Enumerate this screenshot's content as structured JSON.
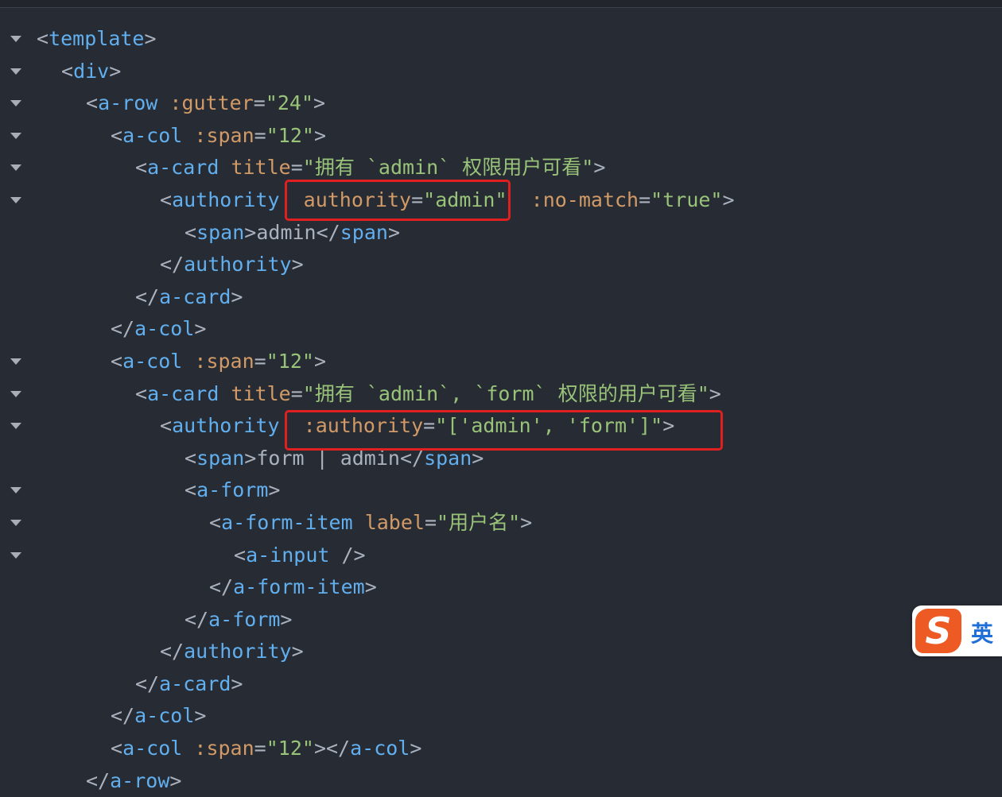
{
  "editor": {
    "lines": [
      {
        "fold": true,
        "indent": 0,
        "tokens": [
          [
            "punct",
            "<"
          ],
          [
            "tag",
            "template"
          ],
          [
            "punct",
            ">"
          ]
        ]
      },
      {
        "fold": true,
        "indent": 1,
        "tokens": [
          [
            "punct",
            "<"
          ],
          [
            "tag",
            "div"
          ],
          [
            "punct",
            ">"
          ]
        ]
      },
      {
        "fold": true,
        "indent": 2,
        "tokens": [
          [
            "punct",
            "<"
          ],
          [
            "tag",
            "a-row"
          ],
          [
            "text",
            " "
          ],
          [
            "attr",
            ":gutter"
          ],
          [
            "punct",
            "="
          ],
          [
            "str",
            "\"24\""
          ],
          [
            "punct",
            ">"
          ]
        ]
      },
      {
        "fold": true,
        "indent": 3,
        "tokens": [
          [
            "punct",
            "<"
          ],
          [
            "tag",
            "a-col"
          ],
          [
            "text",
            " "
          ],
          [
            "attr",
            ":span"
          ],
          [
            "punct",
            "="
          ],
          [
            "str",
            "\"12\""
          ],
          [
            "punct",
            ">"
          ]
        ]
      },
      {
        "fold": true,
        "indent": 4,
        "tokens": [
          [
            "punct",
            "<"
          ],
          [
            "tag",
            "a-card"
          ],
          [
            "text",
            " "
          ],
          [
            "attr",
            "title"
          ],
          [
            "punct",
            "="
          ],
          [
            "str",
            "\"拥有 `admin` 权限用户可看\""
          ],
          [
            "punct",
            ">"
          ]
        ]
      },
      {
        "fold": true,
        "indent": 5,
        "tokens": [
          [
            "punct",
            "<"
          ],
          [
            "tag",
            "authority"
          ],
          [
            "text",
            "  "
          ],
          [
            "attr",
            "authority"
          ],
          [
            "punct",
            "="
          ],
          [
            "str",
            "\"admin\""
          ],
          [
            "text",
            "  "
          ],
          [
            "attr",
            ":no-match"
          ],
          [
            "punct",
            "="
          ],
          [
            "str",
            "\"true\""
          ],
          [
            "punct",
            ">"
          ]
        ]
      },
      {
        "fold": false,
        "indent": 6,
        "tokens": [
          [
            "punct",
            "<"
          ],
          [
            "tag",
            "span"
          ],
          [
            "punct",
            ">"
          ],
          [
            "text",
            "admin"
          ],
          [
            "punct",
            "</"
          ],
          [
            "tag",
            "span"
          ],
          [
            "punct",
            ">"
          ]
        ]
      },
      {
        "fold": false,
        "indent": 5,
        "tokens": [
          [
            "punct",
            "</"
          ],
          [
            "tag",
            "authority"
          ],
          [
            "punct",
            ">"
          ]
        ]
      },
      {
        "fold": false,
        "indent": 4,
        "tokens": [
          [
            "punct",
            "</"
          ],
          [
            "tag",
            "a-card"
          ],
          [
            "punct",
            ">"
          ]
        ]
      },
      {
        "fold": false,
        "indent": 3,
        "tokens": [
          [
            "punct",
            "</"
          ],
          [
            "tag",
            "a-col"
          ],
          [
            "punct",
            ">"
          ]
        ]
      },
      {
        "fold": true,
        "indent": 3,
        "tokens": [
          [
            "punct",
            "<"
          ],
          [
            "tag",
            "a-col"
          ],
          [
            "text",
            " "
          ],
          [
            "attr",
            ":span"
          ],
          [
            "punct",
            "="
          ],
          [
            "str",
            "\"12\""
          ],
          [
            "punct",
            ">"
          ]
        ]
      },
      {
        "fold": true,
        "indent": 4,
        "tokens": [
          [
            "punct",
            "<"
          ],
          [
            "tag",
            "a-card"
          ],
          [
            "text",
            " "
          ],
          [
            "attr",
            "title"
          ],
          [
            "punct",
            "="
          ],
          [
            "str",
            "\"拥有 `admin`, `form` 权限的用户可看\""
          ],
          [
            "punct",
            ">"
          ]
        ]
      },
      {
        "fold": true,
        "indent": 5,
        "tokens": [
          [
            "punct",
            "<"
          ],
          [
            "tag",
            "authority"
          ],
          [
            "text",
            "  "
          ],
          [
            "attr",
            ":authority"
          ],
          [
            "punct",
            "="
          ],
          [
            "str",
            "\"['admin', 'form']\""
          ],
          [
            "punct",
            ">"
          ]
        ]
      },
      {
        "fold": false,
        "indent": 6,
        "tokens": [
          [
            "punct",
            "<"
          ],
          [
            "tag",
            "span"
          ],
          [
            "punct",
            ">"
          ],
          [
            "text",
            "form | admin"
          ],
          [
            "punct",
            "</"
          ],
          [
            "tag",
            "span"
          ],
          [
            "punct",
            ">"
          ]
        ]
      },
      {
        "fold": true,
        "indent": 6,
        "tokens": [
          [
            "punct",
            "<"
          ],
          [
            "tag",
            "a-form"
          ],
          [
            "punct",
            ">"
          ]
        ]
      },
      {
        "fold": true,
        "indent": 7,
        "tokens": [
          [
            "punct",
            "<"
          ],
          [
            "tag",
            "a-form-item"
          ],
          [
            "text",
            " "
          ],
          [
            "attr",
            "label"
          ],
          [
            "punct",
            "="
          ],
          [
            "str",
            "\"用户名\""
          ],
          [
            "punct",
            ">"
          ]
        ]
      },
      {
        "fold": true,
        "indent": 8,
        "tokens": [
          [
            "punct",
            "<"
          ],
          [
            "tag",
            "a-input"
          ],
          [
            "text",
            " "
          ],
          [
            "punct",
            "/>"
          ]
        ]
      },
      {
        "fold": false,
        "indent": 7,
        "tokens": [
          [
            "punct",
            "</"
          ],
          [
            "tag",
            "a-form-item"
          ],
          [
            "punct",
            ">"
          ]
        ]
      },
      {
        "fold": false,
        "indent": 6,
        "tokens": [
          [
            "punct",
            "</"
          ],
          [
            "tag",
            "a-form"
          ],
          [
            "punct",
            ">"
          ]
        ]
      },
      {
        "fold": false,
        "indent": 5,
        "tokens": [
          [
            "punct",
            "</"
          ],
          [
            "tag",
            "authority"
          ],
          [
            "punct",
            ">"
          ]
        ]
      },
      {
        "fold": false,
        "indent": 4,
        "tokens": [
          [
            "punct",
            "</"
          ],
          [
            "tag",
            "a-card"
          ],
          [
            "punct",
            ">"
          ]
        ]
      },
      {
        "fold": false,
        "indent": 3,
        "tokens": [
          [
            "punct",
            "</"
          ],
          [
            "tag",
            "a-col"
          ],
          [
            "punct",
            ">"
          ]
        ]
      },
      {
        "fold": false,
        "indent": 3,
        "tokens": [
          [
            "punct",
            "<"
          ],
          [
            "tag",
            "a-col"
          ],
          [
            "text",
            " "
          ],
          [
            "attr",
            ":span"
          ],
          [
            "punct",
            "="
          ],
          [
            "str",
            "\"12\""
          ],
          [
            "punct",
            "></"
          ],
          [
            "tag",
            "a-col"
          ],
          [
            "punct",
            ">"
          ]
        ]
      },
      {
        "fold": false,
        "indent": 2,
        "tokens": [
          [
            "punct",
            "</"
          ],
          [
            "tag",
            "a-row"
          ],
          [
            "punct",
            ">"
          ]
        ]
      }
    ]
  },
  "ime": {
    "logo": "S",
    "mode": "英"
  },
  "colors": {
    "background": "#272b33",
    "tag": "#61afef",
    "attribute": "#d19a66",
    "string": "#98c379",
    "punctuation": "#abb2bf",
    "highlight": "#e02020"
  }
}
